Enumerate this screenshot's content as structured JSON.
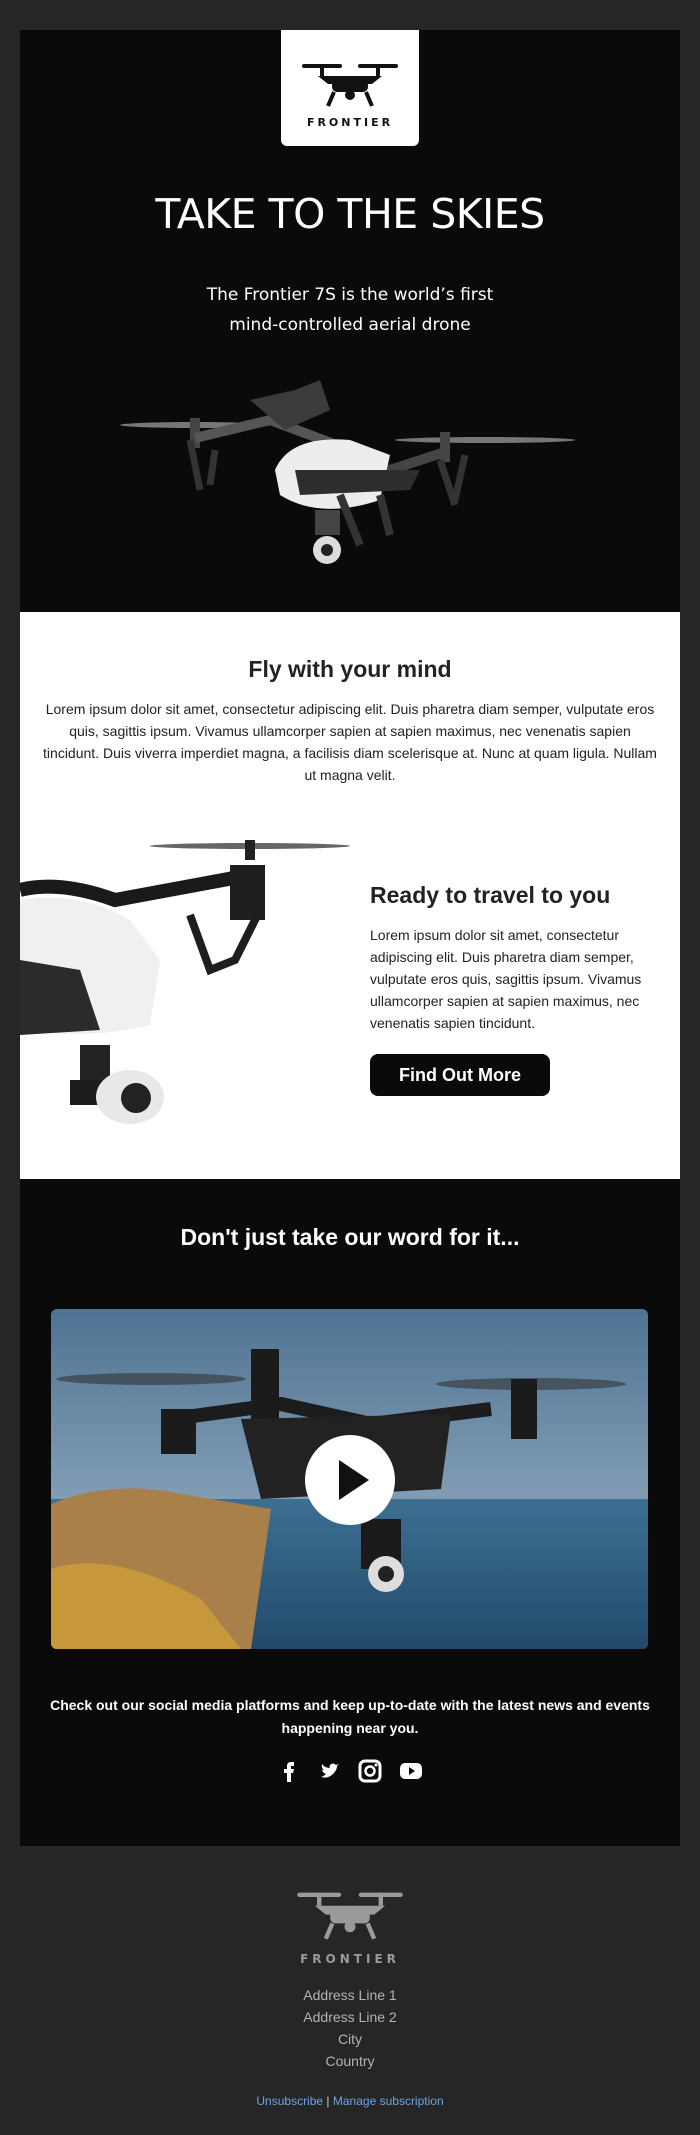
{
  "brand": {
    "name": "FRONTIER"
  },
  "hero": {
    "title": "TAKE TO THE SKIES",
    "subtitle_line1": "The Frontier 7S is the world’s first",
    "subtitle_line2": "mind-controlled aerial drone"
  },
  "intro": {
    "title": "Fly with your mind",
    "body": "Lorem ipsum dolor sit amet, consectetur adipiscing elit. Duis pharetra diam semper, vulputate eros quis, sagittis ipsum. Vivamus ullamcorper sapien at sapien maximus, nec venenatis sapien tincidunt. Duis viverra imperdiet magna, a facilisis diam scelerisque at. Nunc at quam ligula. Nullam ut magna velit."
  },
  "feature": {
    "title": "Ready to travel to you",
    "body": "Lorem ipsum dolor sit amet, consectetur adipiscing elit. Duis pharetra diam semper, vulputate eros quis, sagittis ipsum. Vivamus ullamcorper sapien at sapien maximus, nec venenatis sapien tincidunt.",
    "cta_label": "Find Out More"
  },
  "testimonial": {
    "title": "Don't just take our word for it...",
    "social_text": "Check out our social media platforms and keep up-to-date with the latest news and events happening near you.",
    "socials": [
      "facebook-icon",
      "twitter-icon",
      "instagram-icon",
      "youtube-icon"
    ]
  },
  "footer": {
    "address_line1": "Address Line 1",
    "address_line2": "Address Line 2",
    "city": "City",
    "country": "Country",
    "unsubscribe": "Unsubscribe",
    "separator": "|",
    "manage": "Manage subscription"
  },
  "colors": {
    "page_bg": "#262626",
    "dark_bg": "#0a0a0a",
    "link": "#6aa5e0"
  }
}
